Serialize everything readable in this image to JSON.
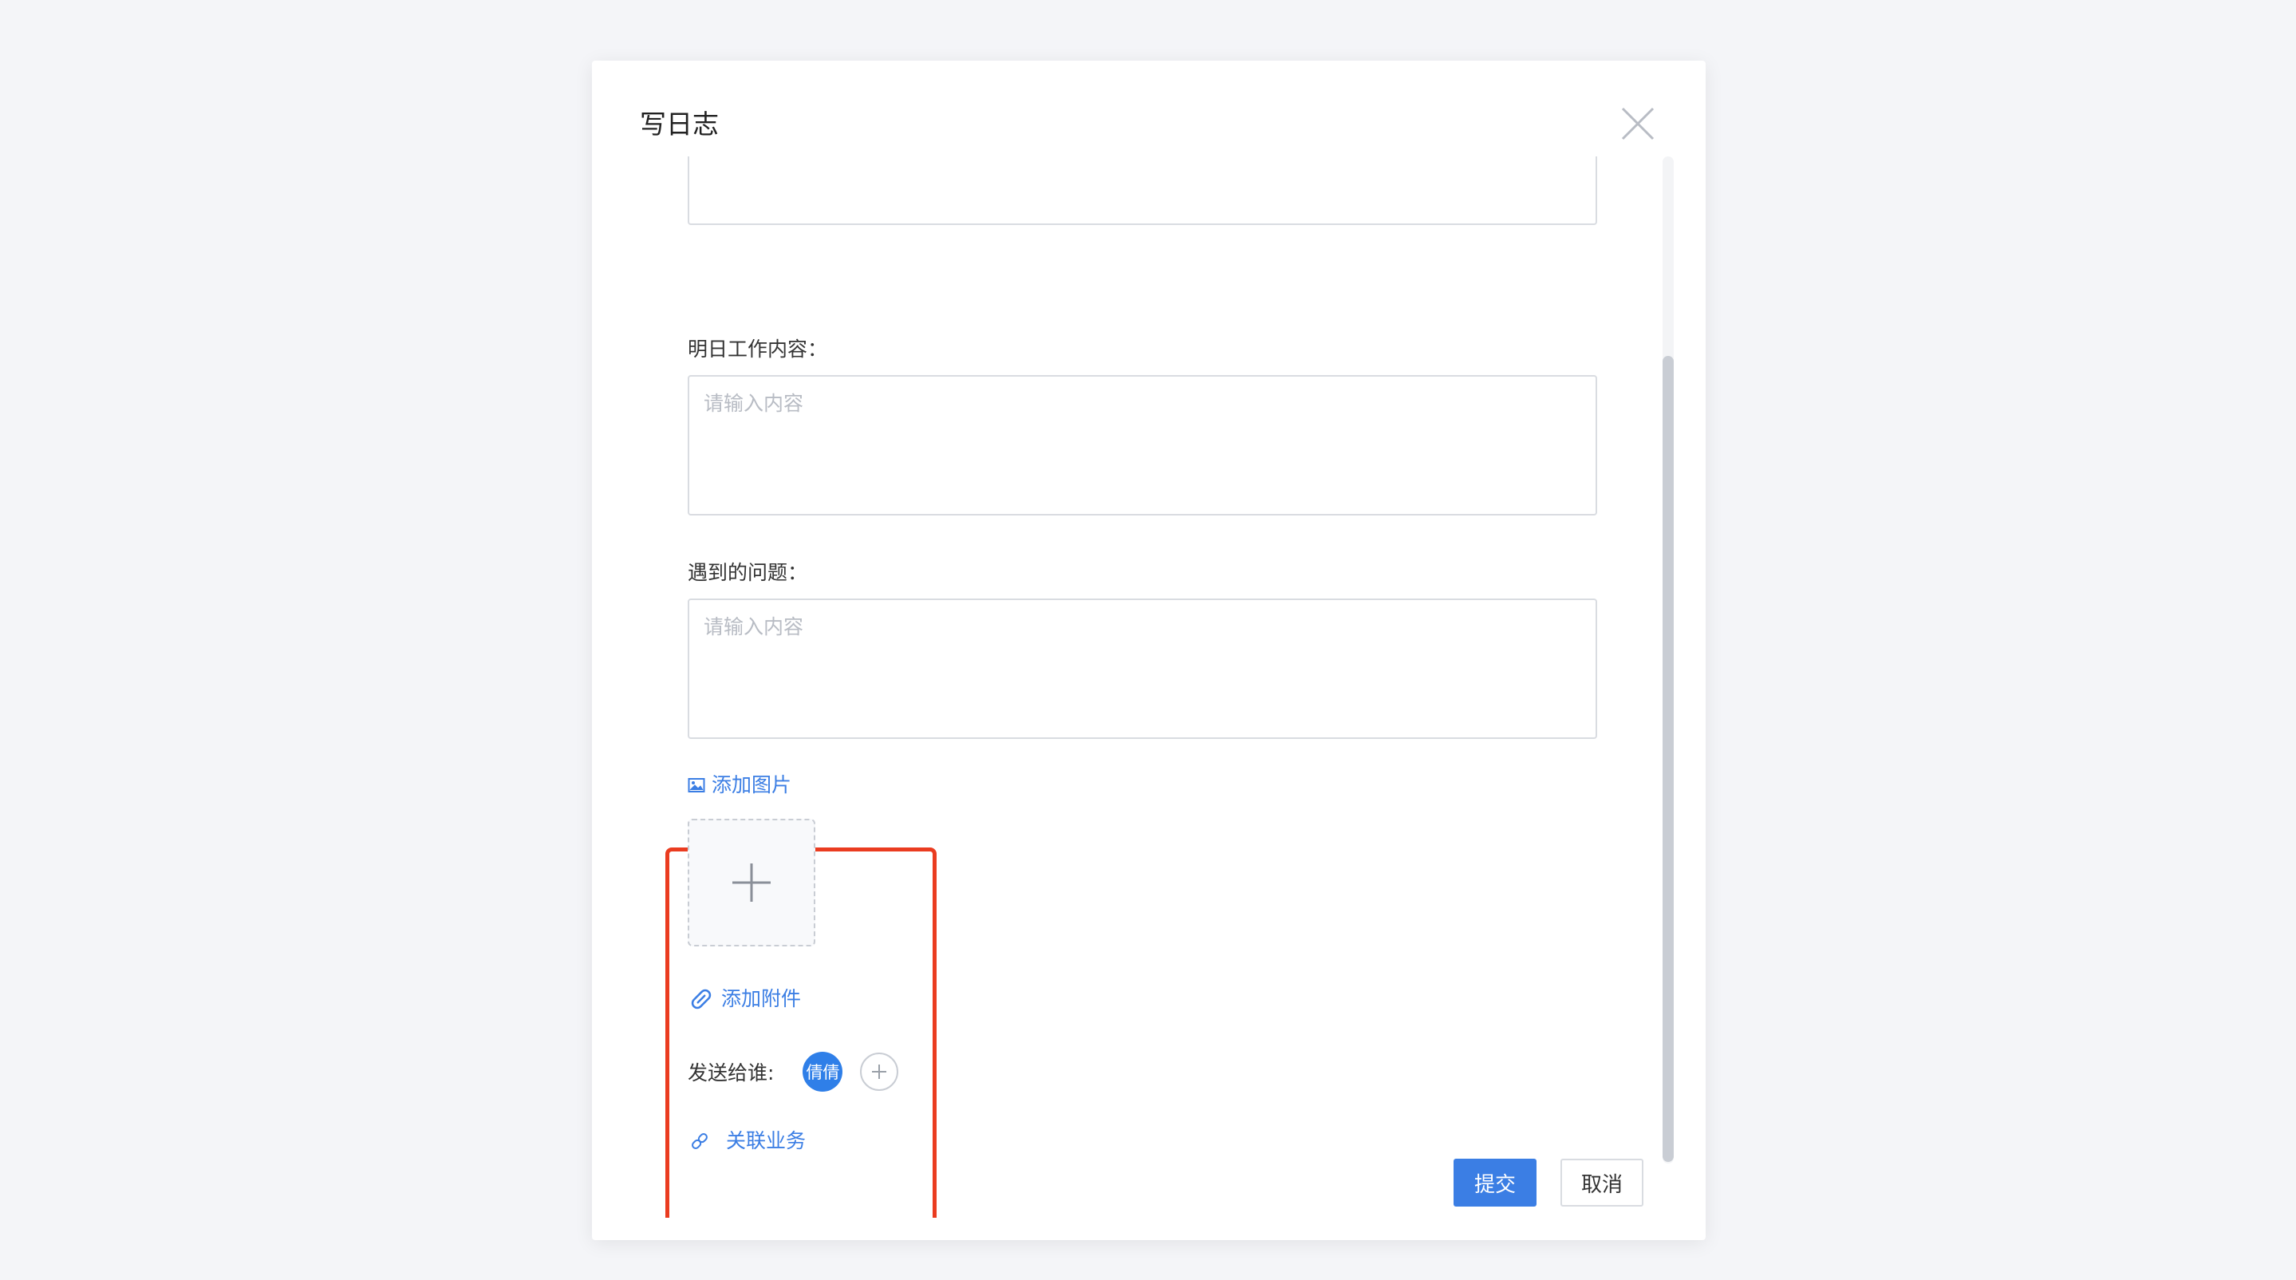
{
  "dialog": {
    "title": "写日志"
  },
  "form": {
    "tomorrow_label": "明日工作内容：",
    "tomorrow_placeholder": "请输入内容",
    "issues_label": "遇到的问题：",
    "issues_placeholder": "请输入内容"
  },
  "attachments": {
    "add_image_label": "添加图片",
    "add_file_label": "添加附件",
    "send_to_label": "发送给谁:",
    "recipient_name": "倩倩",
    "link_business_label": "关联业务"
  },
  "footer": {
    "submit_label": "提交",
    "cancel_label": "取消"
  },
  "colors": {
    "accent": "#3b7ee4",
    "highlight": "#ea3c20",
    "avatar": "#2f7fe8"
  },
  "icons": {
    "close": "close-icon",
    "image": "image-icon",
    "plus": "plus-icon",
    "paperclip": "paperclip-icon",
    "link": "link-icon",
    "add_circle": "add-circle-icon"
  }
}
